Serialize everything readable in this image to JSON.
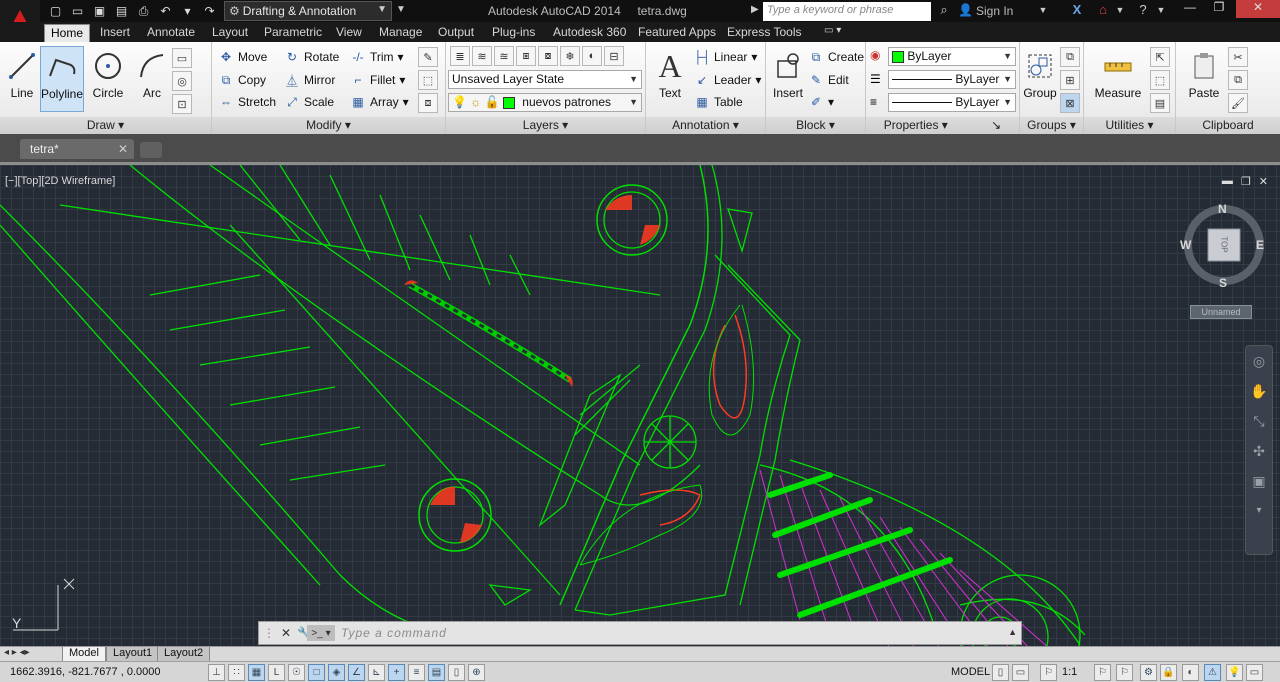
{
  "titlebar": {
    "workspace": "Drafting & Annotation",
    "app_title": "Autodesk AutoCAD 2014",
    "file_title": "tetra.dwg",
    "search_placeholder": "Type a keyword or phrase",
    "sign_in": "Sign In"
  },
  "ribbon_tabs": [
    "Home",
    "Insert",
    "Annotate",
    "Layout",
    "Parametric",
    "View",
    "Manage",
    "Output",
    "Plug-ins",
    "Autodesk 360",
    "Featured Apps",
    "Express Tools"
  ],
  "ribbon": {
    "draw": {
      "title": "Draw",
      "line": "Line",
      "polyline": "Polyline",
      "circle": "Circle",
      "arc": "Arc"
    },
    "modify": {
      "title": "Modify",
      "move": "Move",
      "rotate": "Rotate",
      "trim": "Trim",
      "copy": "Copy",
      "mirror": "Mirror",
      "fillet": "Fillet",
      "stretch": "Stretch",
      "scale": "Scale",
      "array": "Array"
    },
    "layers": {
      "title": "Layers",
      "layer_state": "Unsaved Layer State",
      "current_layer": "nuevos patrones"
    },
    "annotation": {
      "title": "Annotation",
      "text": "Text",
      "linear": "Linear",
      "leader": "Leader",
      "table": "Table"
    },
    "block": {
      "title": "Block",
      "insert": "Insert",
      "create": "Create",
      "edit": "Edit"
    },
    "properties": {
      "title": "Properties",
      "color": "ByLayer",
      "linetype": "ByLayer",
      "lineweight": "ByLayer"
    },
    "groups": {
      "title": "Groups",
      "group": "Group"
    },
    "utilities": {
      "title": "Utilities",
      "measure": "Measure"
    },
    "clipboard": {
      "title": "Clipboard",
      "paste": "Paste"
    }
  },
  "file_tab": {
    "name": "tetra*"
  },
  "viewport": {
    "label": "[−][Top][2D Wireframe]",
    "compass": {
      "n": "N",
      "s": "S",
      "e": "E",
      "w": "W",
      "face": "TOP"
    },
    "wcs": "Unnamed",
    "ucs_y": "Y"
  },
  "command": {
    "placeholder": "Type a command"
  },
  "layout_tabs": [
    "Model",
    "Layout1",
    "Layout2"
  ],
  "status": {
    "coords": "1662.3916, -821.7677 , 0.0000",
    "model": "MODEL",
    "scale": "1:1"
  },
  "colors": {
    "accent": "#00ff00",
    "drawing_bg": "#252b35",
    "highlight": "#ff3b1f",
    "hatch": "#d42fd4"
  }
}
